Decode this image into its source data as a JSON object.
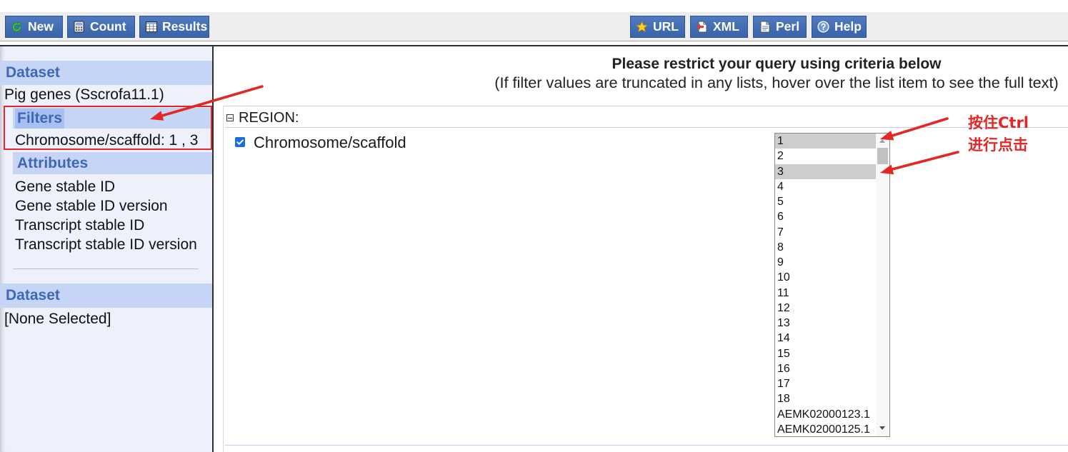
{
  "toolbar": {
    "buttons_left": [
      {
        "label": "New",
        "icon": "refresh-icon"
      },
      {
        "label": "Count",
        "icon": "calculator-icon"
      },
      {
        "label": "Results",
        "icon": "table-icon"
      }
    ],
    "buttons_right": [
      {
        "label": "URL",
        "icon": "star-icon"
      },
      {
        "label": "XML",
        "icon": "xml-export-icon"
      },
      {
        "label": "Perl",
        "icon": "perl-script-icon"
      },
      {
        "label": "Help",
        "icon": "help-icon"
      }
    ]
  },
  "sidebar": {
    "dataset_heading": "Dataset",
    "dataset_name": "Pig genes (Sscrofa11.1)",
    "filters_heading": "Filters",
    "filter_summary": "Chromosome/scaffold: 1 , 3",
    "attributes_heading": "Attributes",
    "attributes": [
      "Gene stable ID",
      "Gene stable ID version",
      "Transcript stable ID",
      "Transcript stable ID version"
    ],
    "second_dataset_heading": "Dataset",
    "second_dataset_value": "[None Selected]"
  },
  "main": {
    "title": "Please restrict your query using criteria below",
    "subtitle": "(If filter values are truncated in any lists, hover over the list item to see the full text)",
    "region": {
      "label": "REGION:",
      "filter": {
        "label": "Chromosome/scaffold",
        "checked": true,
        "options": [
          {
            "value": "1",
            "selected": true
          },
          {
            "value": "2",
            "selected": false
          },
          {
            "value": "3",
            "selected": true
          },
          {
            "value": "4",
            "selected": false
          },
          {
            "value": "5",
            "selected": false
          },
          {
            "value": "6",
            "selected": false
          },
          {
            "value": "7",
            "selected": false
          },
          {
            "value": "8",
            "selected": false
          },
          {
            "value": "9",
            "selected": false
          },
          {
            "value": "10",
            "selected": false
          },
          {
            "value": "11",
            "selected": false
          },
          {
            "value": "12",
            "selected": false
          },
          {
            "value": "13",
            "selected": false
          },
          {
            "value": "14",
            "selected": false
          },
          {
            "value": "15",
            "selected": false
          },
          {
            "value": "16",
            "selected": false
          },
          {
            "value": "17",
            "selected": false
          },
          {
            "value": "18",
            "selected": false
          },
          {
            "value": "AEMK02000123.1",
            "selected": false
          },
          {
            "value": "AEMK02000125.1",
            "selected": false
          }
        ]
      }
    }
  },
  "annotation": {
    "note_line1": "按住Ctrl",
    "note_line2": "进行点击"
  },
  "colors": {
    "button_blue": "#3d6bb7",
    "sidebar_bg": "#eef0fc",
    "heading_bg": "#c6d4f6",
    "heading_highlight": "#a8bff1",
    "heading_text": "#3e68b6",
    "annotation_red": "#e32626",
    "selection_gray": "#cdcdcd",
    "checkbox_blue": "#1a6fe0"
  }
}
